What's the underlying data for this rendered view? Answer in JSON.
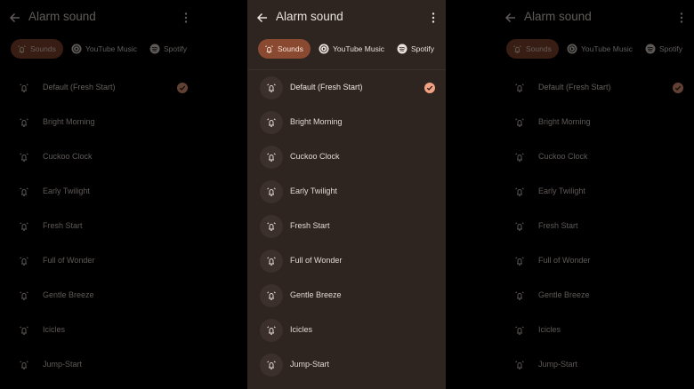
{
  "colors": {
    "accent": "#f2a283",
    "chip_selected_bg": "#8a4a32",
    "surface": "#2e2420"
  },
  "header": {
    "title": "Alarm sound"
  },
  "tabs": [
    {
      "label": "Sounds",
      "icon": "alarm-bell-icon",
      "selected": true
    },
    {
      "label": "YouTube Music",
      "icon": "youtube-music-icon",
      "selected": false
    },
    {
      "label": "Spotify",
      "icon": "spotify-icon",
      "selected": false
    }
  ],
  "sounds": [
    {
      "label": "Default (Fresh Start)",
      "selected": true
    },
    {
      "label": "Bright Morning",
      "selected": false
    },
    {
      "label": "Cuckoo Clock",
      "selected": false
    },
    {
      "label": "Early Twilight",
      "selected": false
    },
    {
      "label": "Fresh Start",
      "selected": false
    },
    {
      "label": "Full of Wonder",
      "selected": false
    },
    {
      "label": "Gentle Breeze",
      "selected": false
    },
    {
      "label": "Icicles",
      "selected": false
    },
    {
      "label": "Jump-Start",
      "selected": false
    }
  ]
}
